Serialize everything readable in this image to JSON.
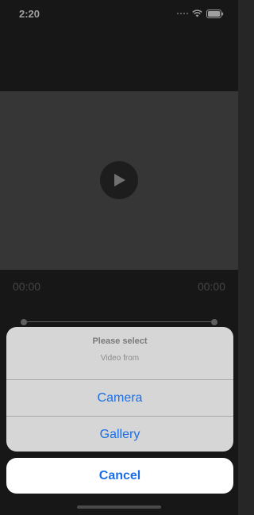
{
  "status_bar": {
    "time": "2:20",
    "icons": [
      "signal-icon",
      "wifi-icon",
      "battery-icon"
    ]
  },
  "player": {
    "play_icon": "play-icon",
    "current_time": "00:00",
    "total_time": "00:00"
  },
  "action_sheet": {
    "title": "Please select",
    "message": "Video from",
    "actions": [
      "Camera",
      "Gallery"
    ],
    "cancel_label": "Cancel",
    "action_color": "#1a6fe8"
  }
}
